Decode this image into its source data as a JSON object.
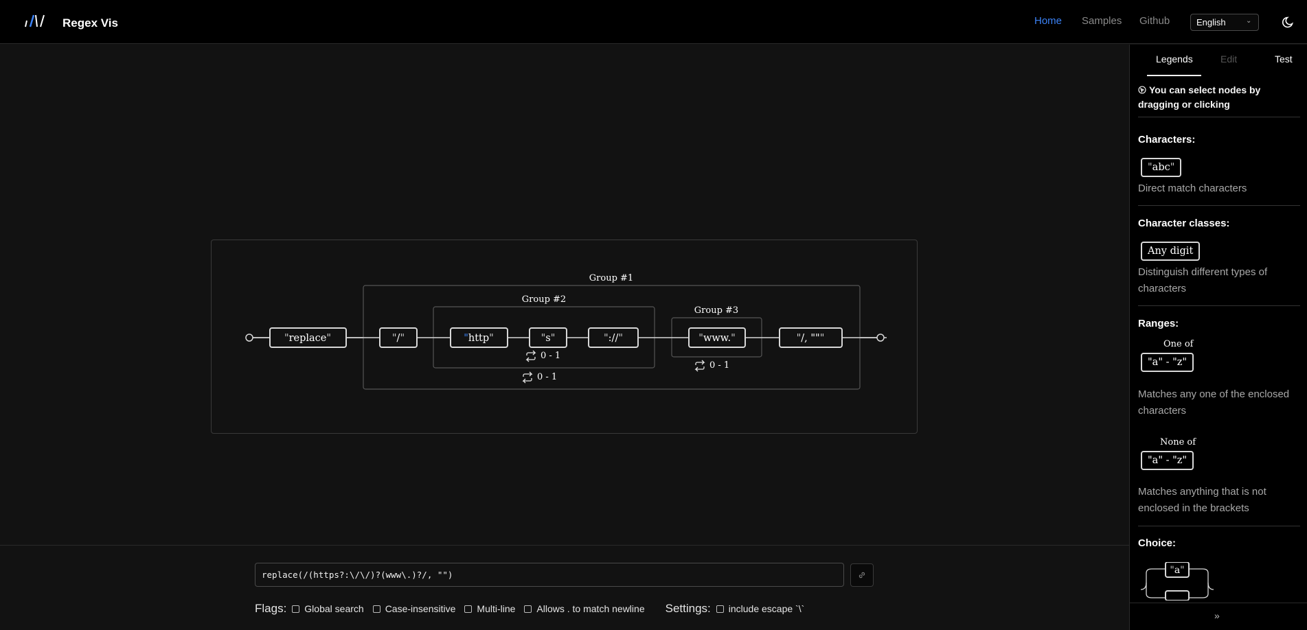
{
  "app": {
    "name": "Regex Vis"
  },
  "nav": {
    "home": "Home",
    "samples": "Samples",
    "github": "Github",
    "language": "English"
  },
  "diagram": {
    "start_node": "",
    "nodes": [
      {
        "text": "replace"
      },
      {
        "text": "/"
      },
      {
        "text": "http"
      },
      {
        "text": "s"
      },
      {
        "text": "://"
      },
      {
        "text": "www."
      },
      {
        "text": "/, \"\""
      }
    ],
    "groups": [
      {
        "label": "Group #1"
      },
      {
        "label": "Group #2"
      },
      {
        "label": "Group #3"
      }
    ],
    "quantifiers": [
      {
        "text": "0 - 1"
      },
      {
        "text": "0 - 1"
      },
      {
        "text": "0 - 1"
      }
    ]
  },
  "input": {
    "regex": "replace(/(https?:\\/\\/)?(www\\.)?/, \"\")"
  },
  "flags": {
    "label": "Flags:",
    "items": [
      "Global search",
      "Case-insensitive",
      "Multi-line",
      "Allows . to match newline"
    ]
  },
  "settings": {
    "label": "Settings:",
    "items": [
      "include escape `\\`"
    ]
  },
  "panel": {
    "tabs": [
      "Legends",
      "Edit",
      "Test"
    ],
    "hint": "You can select nodes by dragging or clicking",
    "sections": {
      "characters": {
        "title": "Characters:",
        "example": "abc",
        "desc": "Direct match characters"
      },
      "classes": {
        "title": "Character classes:",
        "example": "Any digit",
        "desc": "Distinguish different types of characters"
      },
      "ranges": {
        "title": "Ranges:",
        "one_of_label": "One of",
        "one_of_example": "\"a\" - \"z\"",
        "one_of_desc": "Matches any one of the enclosed characters",
        "none_of_label": "None of",
        "none_of_example": "\"a\" - \"z\"",
        "none_of_desc": "Matches anything that is not enclosed in the brackets"
      },
      "choice": {
        "title": "Choice:",
        "example": "a"
      }
    }
  }
}
